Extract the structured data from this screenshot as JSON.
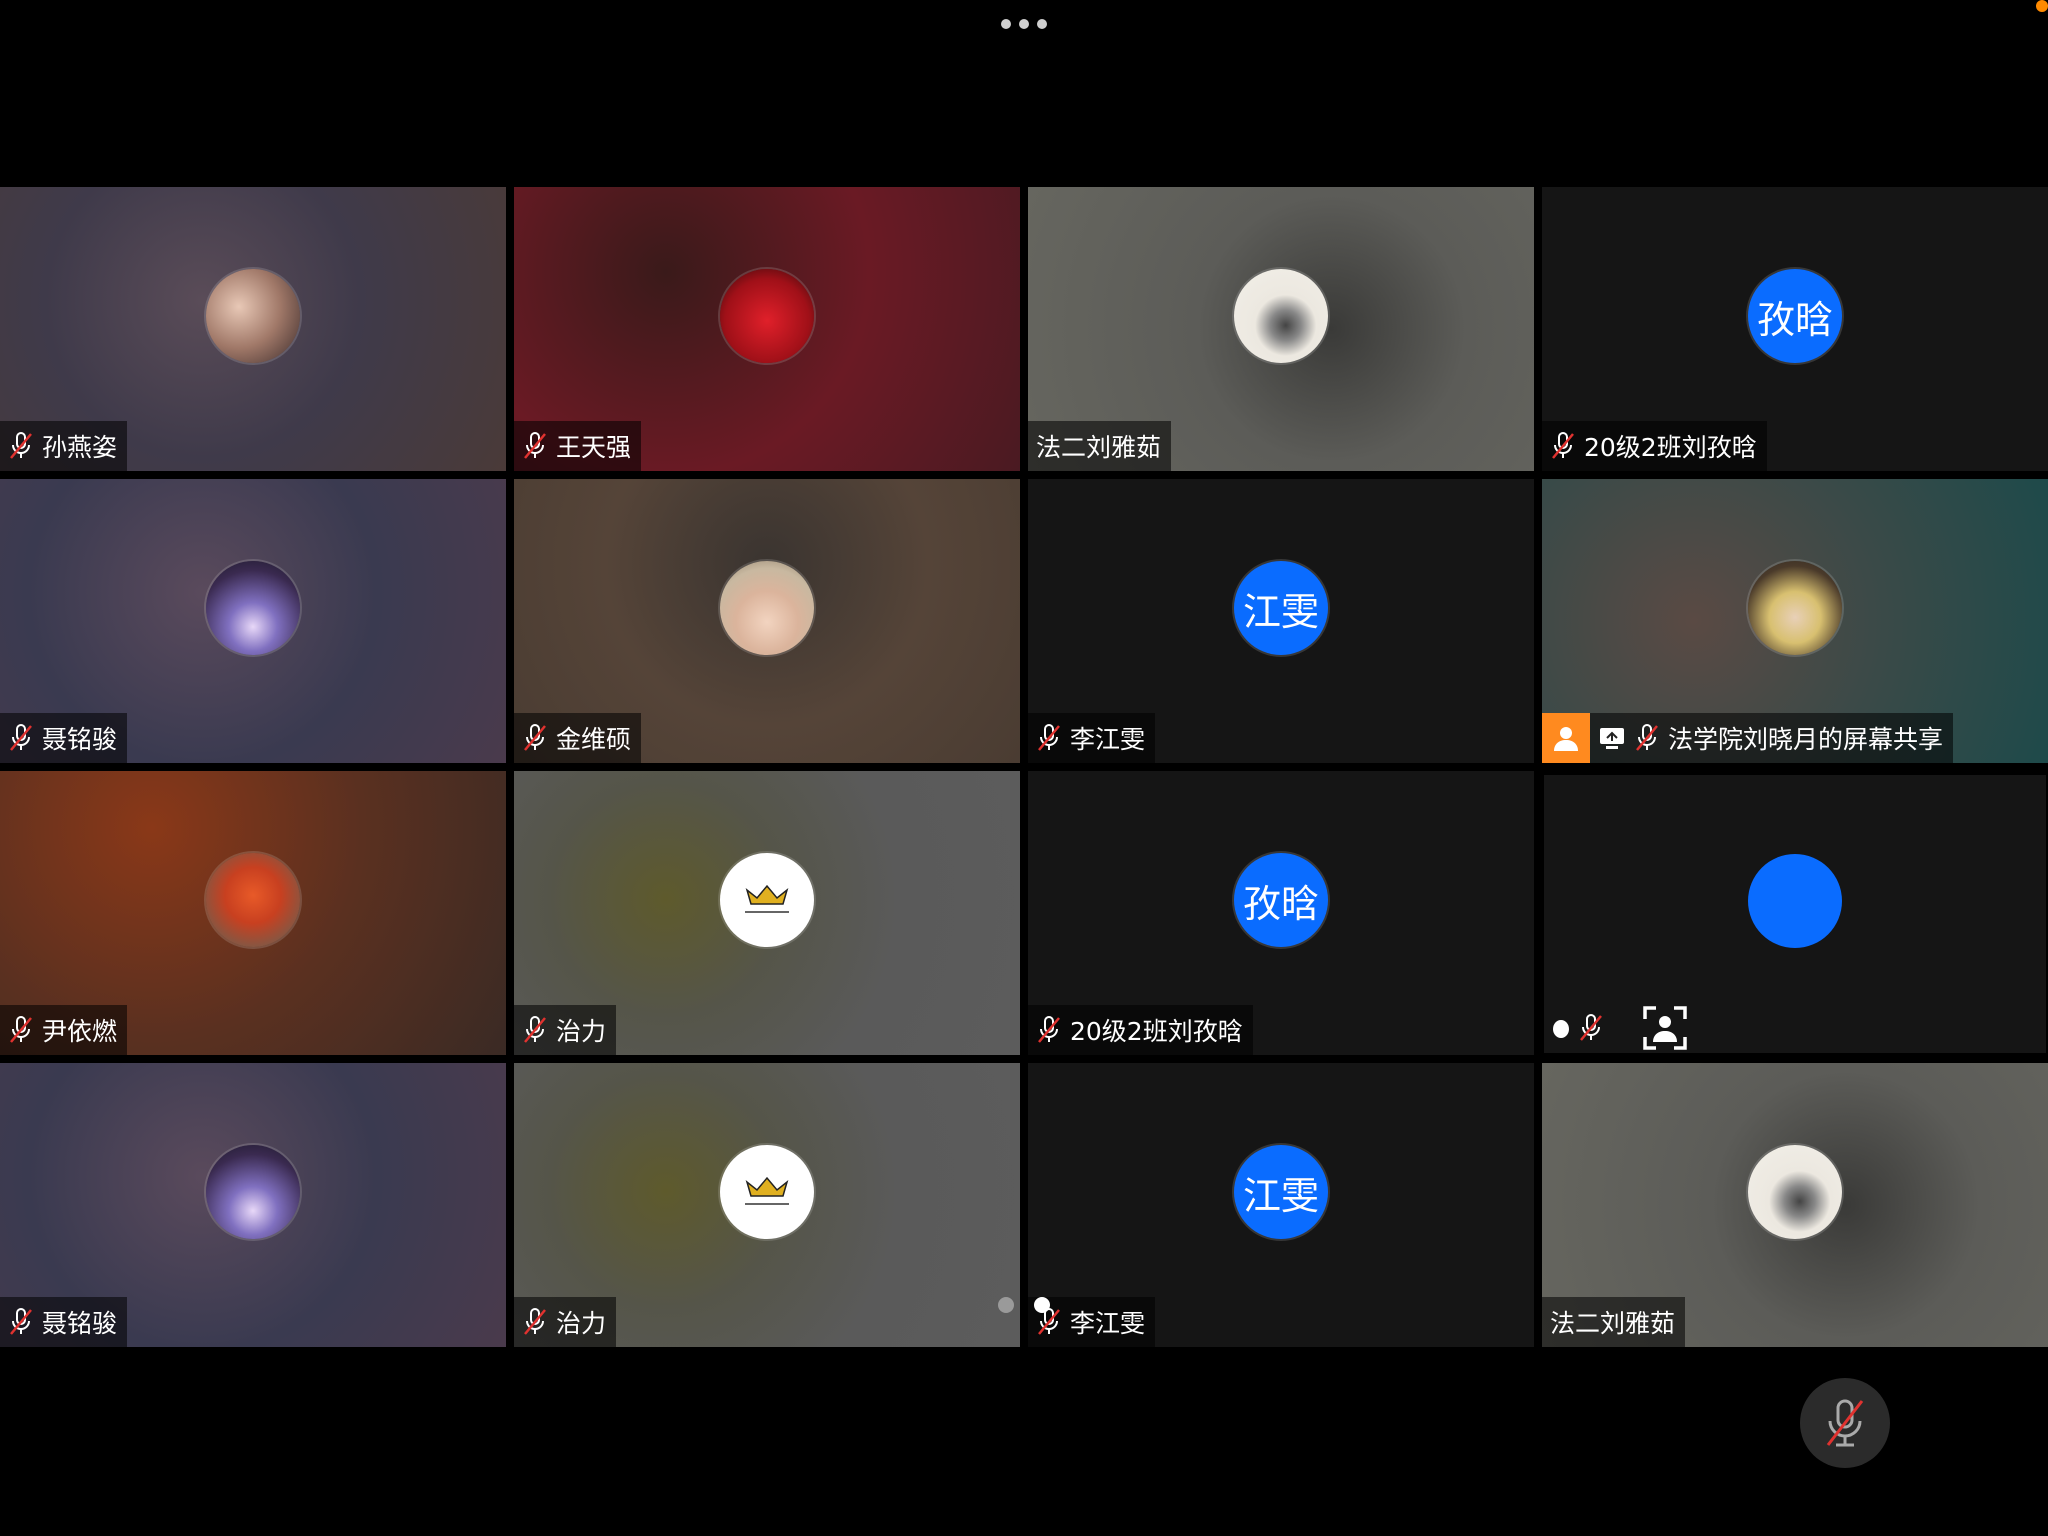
{
  "top_bar": {
    "more_icon": "more-dots-icon"
  },
  "tiles": [
    {
      "name": "孙燕姿",
      "avatar_text": "",
      "muted": true
    },
    {
      "name": "王天强",
      "avatar_text": "",
      "muted": true
    },
    {
      "name": "法二刘雅茹",
      "avatar_text": "",
      "muted": false
    },
    {
      "name": "20级2班刘孜晗",
      "avatar_text": "孜晗",
      "muted": true
    },
    {
      "name": "聂铭骏",
      "avatar_text": "",
      "muted": true
    },
    {
      "name": "金维硕",
      "avatar_text": "",
      "muted": true
    },
    {
      "name": "李江雯",
      "avatar_text": "江雯",
      "muted": true
    },
    {
      "name": "法学院刘晓月的屏幕共享",
      "avatar_text": "",
      "muted": true,
      "screen_share": true
    },
    {
      "name": "尹依燃",
      "avatar_text": "",
      "muted": true
    },
    {
      "name": "治力",
      "avatar_text": "",
      "muted": true
    },
    {
      "name": "20级2班刘孜晗",
      "avatar_text": "孜晗",
      "muted": true
    },
    {
      "name": "",
      "avatar_text": "",
      "muted": true,
      "self_view": true
    },
    {
      "name": "聂铭骏",
      "avatar_text": "",
      "muted": true
    },
    {
      "name": "治力",
      "avatar_text": "",
      "muted": true
    },
    {
      "name": "李江雯",
      "avatar_text": "江雯",
      "muted": true
    },
    {
      "name": "法二刘雅茹",
      "avatar_text": "",
      "muted": false
    }
  ],
  "colors": {
    "accent": "#0a6cff",
    "share_badge": "#ff8a1f",
    "mute_slash": "#e0322f"
  },
  "controls": {
    "mute_icon": "mic-off-icon"
  }
}
